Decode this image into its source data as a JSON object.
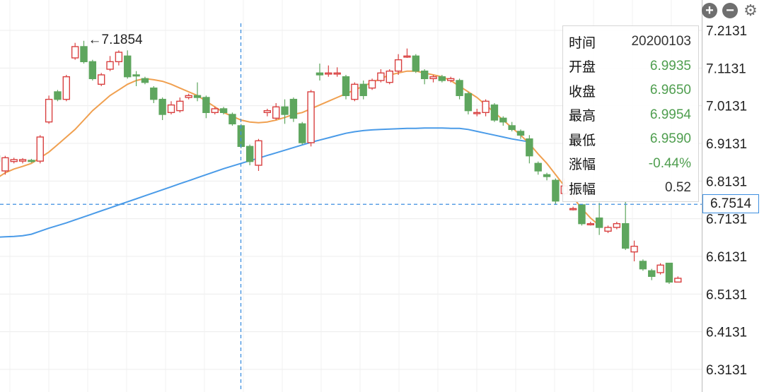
{
  "toolbar": {
    "zoom_in": "+",
    "zoom_out": "−",
    "settings": "⚙",
    "zoom_in_icon": "plus-circle-icon",
    "zoom_out_icon": "minus-circle-icon",
    "settings_icon": "gear-icon"
  },
  "tooltip": {
    "rows": [
      {
        "label": "时间",
        "value": "20200103"
      },
      {
        "label": "开盘",
        "value": "6.9935"
      },
      {
        "label": "收盘",
        "value": "6.9650"
      },
      {
        "label": "最高",
        "value": "6.9954"
      },
      {
        "label": "最低",
        "value": "6.9590"
      },
      {
        "label": "涨幅",
        "value": "-0.44%"
      },
      {
        "label": "振幅",
        "value": "0.52"
      }
    ]
  },
  "crosshair": {
    "price_label": "6.7514",
    "price": 6.7514
  },
  "colors": {
    "up": "#d94040",
    "down": "#5ea65e",
    "ma_short": "#f0a050",
    "ma_long": "#4a9be8",
    "crosshair": "#3d8fe0"
  },
  "chart_data": {
    "type": "candlestick",
    "y_ticks": [
      "7.2131",
      "7.1131",
      "7.0131",
      "6.9131",
      "6.8131",
      "6.7131",
      "6.6131",
      "6.5131",
      "6.4131",
      "6.3131"
    ],
    "ylim": [
      6.29,
      7.23
    ],
    "max_annotation": {
      "label": "←7.1854",
      "value": 7.1854
    },
    "grid": true,
    "candles": [
      [
        6.88,
        6.865,
        6.885,
        6.855
      ],
      [
        6.84,
        6.875,
        6.88,
        6.83
      ],
      [
        6.865,
        6.87,
        6.875,
        6.86
      ],
      [
        6.866,
        6.87,
        6.874,
        6.86
      ],
      [
        6.868,
        6.866,
        6.872,
        6.862
      ],
      [
        6.866,
        6.93,
        6.935,
        6.86
      ],
      [
        6.97,
        7.03,
        7.04,
        6.965
      ],
      [
        7.05,
        7.03,
        7.055,
        7.025
      ],
      [
        7.03,
        7.09,
        7.095,
        7.025
      ],
      [
        7.14,
        7.17,
        7.18,
        7.135
      ],
      [
        7.17,
        7.13,
        7.1854,
        7.125
      ],
      [
        7.13,
        7.085,
        7.135,
        7.08
      ],
      [
        7.07,
        7.095,
        7.1,
        7.065
      ],
      [
        7.11,
        7.13,
        7.145,
        7.105
      ],
      [
        7.13,
        7.155,
        7.16,
        7.12
      ],
      [
        7.145,
        7.09,
        7.16,
        7.085
      ],
      [
        7.095,
        7.092,
        7.105,
        7.065
      ],
      [
        7.085,
        7.075,
        7.09,
        7.07
      ],
      [
        7.06,
        7.03,
        7.065,
        7.02
      ],
      [
        7.03,
        6.99,
        7.035,
        6.975
      ],
      [
        6.995,
        7.015,
        7.025,
        6.99
      ],
      [
        7.0,
        7.025,
        7.035,
        6.995
      ],
      [
        7.035,
        7.04,
        7.045,
        7.03
      ],
      [
        7.04,
        7.035,
        7.075,
        7.025
      ],
      [
        7.035,
        6.995,
        7.04,
        6.98
      ],
      [
        6.995,
        7.005,
        7.01,
        6.99
      ],
      [
        7.005,
        6.995,
        7.01,
        6.99
      ],
      [
        6.99,
        6.965,
        6.995,
        6.96
      ],
      [
        6.96,
        6.905,
        6.965,
        6.9
      ],
      [
        6.905,
        6.865,
        6.91,
        6.855
      ],
      [
        6.855,
        6.92,
        6.925,
        6.84
      ],
      [
        6.995,
        7.0,
        7.005,
        6.985
      ],
      [
        6.98,
        7.01,
        7.02,
        6.975
      ],
      [
        7.01,
        6.99,
        7.03,
        6.965
      ],
      [
        7.03,
        6.98,
        7.035,
        6.97
      ],
      [
        6.965,
        6.915,
        6.97,
        6.91
      ],
      [
        6.915,
        7.05,
        7.055,
        6.905
      ],
      [
        7.1,
        7.095,
        7.125,
        7.08
      ],
      [
        7.1,
        7.1,
        7.12,
        7.09
      ],
      [
        7.1,
        7.1,
        7.115,
        7.09
      ],
      [
        7.09,
        7.04,
        7.095,
        7.03
      ],
      [
        7.03,
        7.07,
        7.075,
        7.025
      ],
      [
        7.07,
        7.04,
        7.08,
        7.03
      ],
      [
        7.06,
        7.08,
        7.085,
        7.055
      ],
      [
        7.08,
        7.1,
        7.11,
        7.075
      ],
      [
        7.075,
        7.105,
        7.11,
        7.07
      ],
      [
        7.105,
        7.135,
        7.15,
        7.095
      ],
      [
        7.145,
        7.145,
        7.165,
        7.14
      ],
      [
        7.145,
        7.105,
        7.15,
        7.1
      ],
      [
        7.105,
        7.085,
        7.11,
        7.07
      ],
      [
        7.085,
        7.09,
        7.095,
        7.075
      ],
      [
        7.09,
        7.08,
        7.095,
        7.075
      ],
      [
        7.08,
        7.085,
        7.09,
        7.075
      ],
      [
        7.08,
        7.04,
        7.085,
        7.03
      ],
      [
        7.045,
        7.0,
        7.05,
        6.99
      ],
      [
        6.995,
        6.995,
        7.005,
        6.985
      ],
      [
        6.995,
        7.025,
        7.03,
        6.985
      ],
      [
        7.015,
        6.975,
        7.02,
        6.97
      ],
      [
        6.98,
        6.97,
        6.985,
        6.96
      ],
      [
        6.96,
        6.95,
        6.97,
        6.945
      ],
      [
        6.945,
        6.935,
        6.95,
        6.925
      ],
      [
        6.925,
        6.88,
        6.935,
        6.86
      ],
      [
        6.86,
        6.84,
        6.865,
        6.83
      ],
      [
        6.83,
        6.825,
        6.835,
        6.815
      ],
      [
        6.815,
        6.76,
        6.82,
        6.75
      ],
      [
        6.78,
        6.8,
        6.82,
        6.775
      ],
      [
        6.74,
        6.74,
        6.745,
        6.735
      ],
      [
        6.75,
        6.7,
        6.75,
        6.695
      ],
      [
        6.7,
        6.7,
        6.705,
        6.695
      ],
      [
        6.715,
        6.69,
        6.755,
        6.67
      ],
      [
        6.68,
        6.69,
        6.695,
        6.675
      ],
      [
        6.69,
        6.7,
        6.705,
        6.685
      ],
      [
        6.7,
        6.635,
        6.76,
        6.63
      ],
      [
        6.625,
        6.64,
        6.655,
        6.6
      ],
      [
        6.6,
        6.58,
        6.605,
        6.575
      ],
      [
        6.575,
        6.56,
        6.58,
        6.55
      ],
      [
        6.57,
        6.59,
        6.595,
        6.565
      ],
      [
        6.595,
        6.545,
        6.595,
        6.54
      ],
      [
        6.545,
        6.555,
        6.56,
        6.545
      ]
    ],
    "ma_short": [
      6.82,
      6.835,
      6.845,
      6.852,
      6.86,
      6.875,
      6.89,
      6.91,
      6.93,
      6.95,
      6.975,
      7.0,
      7.02,
      7.04,
      7.055,
      7.07,
      7.08,
      7.085,
      7.082,
      7.078,
      7.07,
      7.06,
      7.05,
      7.04,
      7.025,
      7.01,
      6.995,
      6.985,
      6.975,
      6.97,
      6.968,
      6.97,
      6.975,
      6.982,
      6.99,
      6.995,
      7.005,
      7.015,
      7.025,
      7.035,
      7.045,
      7.055,
      7.065,
      7.075,
      7.085,
      7.095,
      7.1,
      7.105,
      7.105,
      7.1,
      7.095,
      7.09,
      7.08,
      7.065,
      7.05,
      7.035,
      7.015,
      6.995,
      6.975,
      6.955,
      6.935,
      6.912,
      6.885,
      6.86,
      6.83,
      6.8,
      6.77,
      6.74,
      6.715,
      6.695
    ],
    "ma_long": [
      6.664,
      6.665,
      6.666,
      6.668,
      6.672,
      6.68,
      6.688,
      6.695,
      6.702,
      6.71,
      6.718,
      6.726,
      6.734,
      6.742,
      6.75,
      6.758,
      6.766,
      6.774,
      6.782,
      6.79,
      6.798,
      6.806,
      6.814,
      6.822,
      6.83,
      6.838,
      6.846,
      6.853,
      6.86,
      6.867,
      6.874,
      6.881,
      6.888,
      6.895,
      6.902,
      6.909,
      6.916,
      6.922,
      6.928,
      6.934,
      6.94,
      6.944,
      6.947,
      6.949,
      6.95,
      6.951,
      6.952,
      6.953,
      6.953,
      6.954,
      6.954,
      6.954,
      6.953,
      6.953,
      6.95,
      6.945,
      6.94,
      6.935,
      6.93,
      6.925,
      6.921,
      6.917
    ]
  }
}
